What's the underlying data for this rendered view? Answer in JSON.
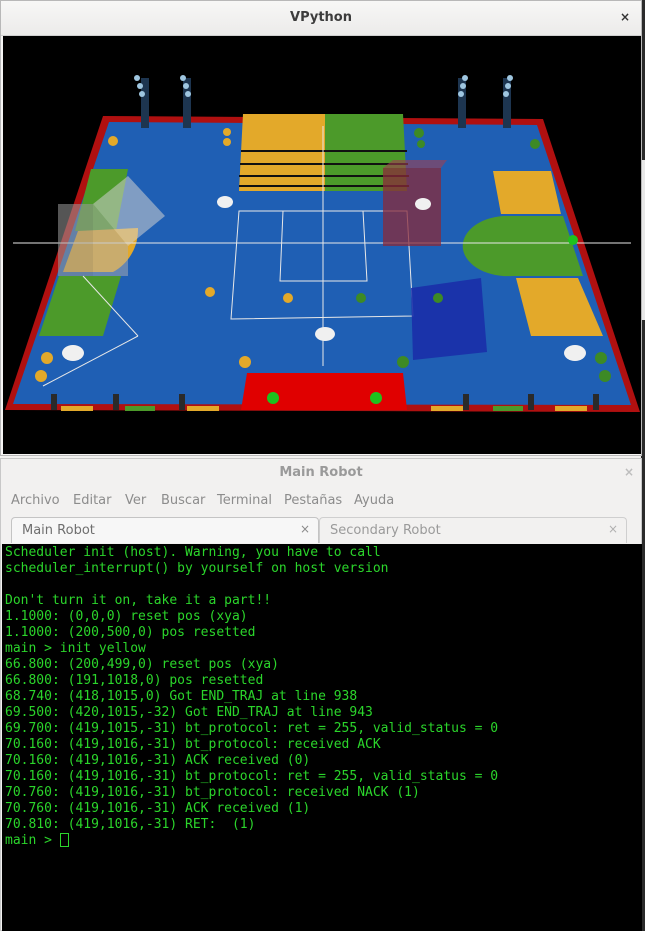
{
  "vpython": {
    "title": "VPython",
    "close": "×"
  },
  "terminal": {
    "title": "Main Robot",
    "close": "×",
    "menu": [
      "Archivo",
      "Editar",
      "Ver",
      "Buscar",
      "Terminal",
      "Pestañas",
      "Ayuda"
    ],
    "tabs": [
      {
        "label": "Main Robot",
        "close": "×",
        "active": true
      },
      {
        "label": "Secondary Robot",
        "close": "×",
        "active": false
      }
    ],
    "lines": [
      "Scheduler init (host). Warning, you have to call",
      "scheduler_interrupt() by yourself on host version",
      "",
      "Don't turn it on, take it a part!!",
      "1.1000: (0,0,0) reset pos (xya)",
      "1.1000: (200,500,0) pos resetted",
      "main > init yellow",
      "66.800: (200,499,0) reset pos (xya)",
      "66.800: (191,1018,0) pos resetted",
      "68.740: (418,1015,0) Got END_TRAJ at line 938",
      "69.500: (420,1015,-32) Got END_TRAJ at line 943",
      "69.700: (419,1015,-31) bt_protocol: ret = 255, valid_status = 0",
      "70.160: (419,1016,-31) bt_protocol: received ACK",
      "70.160: (419,1016,-31) ACK received (0)",
      "70.160: (419,1016,-31) bt_protocol: ret = 255, valid_status = 0",
      "70.760: (419,1016,-31) bt_protocol: received NACK (1)",
      "70.760: (419,1016,-31) ACK received (1)",
      "70.810: (419,1016,-31) RET:  (1)"
    ],
    "prompt": "main > "
  },
  "colors": {
    "board_blue": "#1f5fb4",
    "board_border": "#b01010",
    "zone_yellow": "#e3a92a",
    "zone_green": "#4c9a2a",
    "zone_red": "#e00000",
    "terminal_text": "#2bd52b"
  }
}
